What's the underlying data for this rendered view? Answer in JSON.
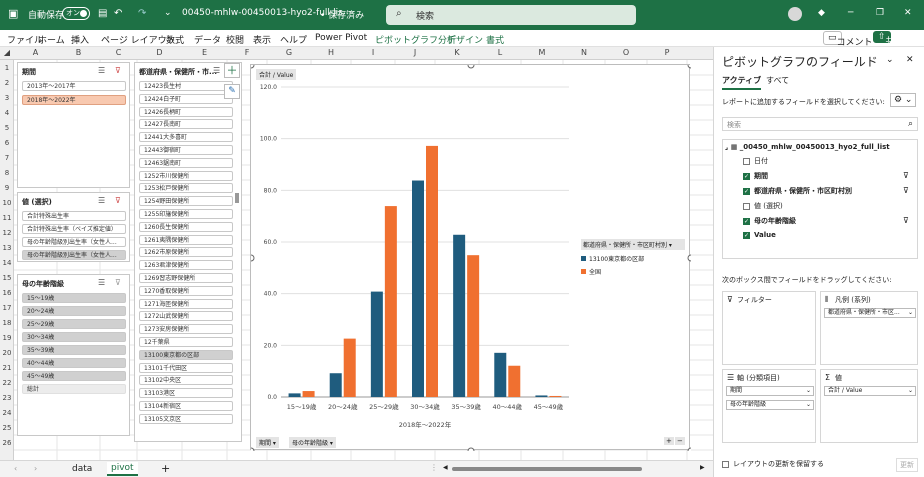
{
  "titlebar": {
    "autosave": "自動保存",
    "toggle": "オン",
    "filename": "00450-mhlw-00450013-hyo2-full-lis···",
    "saved": "• 保存済み",
    "search": "検索"
  },
  "menu": [
    "ファイル",
    "ホーム",
    "挿入",
    "ページ レイアウト",
    "数式",
    "データ",
    "校閲",
    "表示",
    "ヘルプ",
    "Power Pivot",
    "ピボットグラフ分析",
    "デザイン",
    "書式"
  ],
  "menu_right": {
    "comment": "コメント",
    "share": "共有"
  },
  "columns": [
    "A",
    "B",
    "C",
    "D",
    "E",
    "F",
    "G",
    "H",
    "I",
    "J",
    "K",
    "L",
    "M",
    "N",
    "O",
    "P"
  ],
  "rows": [
    "1",
    "2",
    "3",
    "4",
    "5",
    "6",
    "7",
    "8",
    "9",
    "10",
    "11",
    "12",
    "13",
    "14",
    "15",
    "16",
    "17",
    "18",
    "19",
    "20",
    "21",
    "22",
    "23",
    "24",
    "25",
    "26"
  ],
  "slicer_period": {
    "title": "期間",
    "items": [
      "2013年～2017年",
      "2018年～2022年"
    ]
  },
  "slicer_value": {
    "title": "値 (選択)",
    "items": [
      "合計特殊出生率",
      "合計特殊出生率（ベイズ推定値）",
      "母の年齢階級別出生率（女性人...",
      "母の年齢階級別出生率（女性人..."
    ]
  },
  "slicer_age": {
    "title": "母の年齢階級",
    "items": [
      "15～19歳",
      "20～24歳",
      "25～29歳",
      "30～34歳",
      "35～39歳",
      "40～44歳",
      "45～49歳",
      "総計"
    ]
  },
  "slicer_pref": {
    "title": "都道府県・保健所・市...",
    "items": [
      "12423長生村",
      "12424白子町",
      "12426長柄町",
      "12427長南町",
      "12441大多喜町",
      "12443御宿町",
      "12463鋸南町",
      "1252市川保健所",
      "1253松戸保健所",
      "1254野田保健所",
      "1255印旛保健所",
      "1260長生保健所",
      "1261夷隅保健所",
      "1262市原保健所",
      "1263君津保健所",
      "1269習志野保健所",
      "1270香取保健所",
      "1271海匝保健所",
      "1272山武保健所",
      "1273安房保健所",
      "12千葉県",
      "13100東京都の区部",
      "13101千代田区",
      "13102中央区",
      "13103港区",
      "13104新宿区",
      "13105文京区"
    ]
  },
  "chart": {
    "value_label": "合計 / Value",
    "legend_title": "都道府県・保健所・市区町村別",
    "xlabel": "2018年～2022年",
    "axis_button": "期間",
    "axis_button2": "母の年齢階級"
  },
  "chart_data": {
    "type": "bar",
    "categories": [
      "15～19歳",
      "20～24歳",
      "25～29歳",
      "30～34歳",
      "35～39歳",
      "40～44歳",
      "45～49歳"
    ],
    "series": [
      {
        "name": "13100東京都の区部",
        "color": "#1f5c7e",
        "values": [
          1.4,
          9.2,
          40.8,
          83.8,
          62.8,
          17.1,
          0.6
        ]
      },
      {
        "name": "全国",
        "color": "#f07030",
        "values": [
          2.3,
          22.6,
          73.9,
          97.2,
          54.9,
          12.1,
          0.4
        ]
      }
    ],
    "ylim": [
      0,
      120
    ],
    "yticks": [
      "0.0",
      "20.0",
      "40.0",
      "60.0",
      "80.0",
      "100.0",
      "120.0"
    ]
  },
  "field_panel": {
    "title": "ピボットグラフのフィールド",
    "tab_active": "アクティブ",
    "tab_all": "すべて",
    "instruction": "レポートに追加するフィールドを選択してください:",
    "search_placeholder": "検索",
    "table_name": "_00450_mhlw_00450013_hyo2_full_list",
    "fields": [
      {
        "label": "日付",
        "checked": false
      },
      {
        "label": "期間",
        "checked": true
      },
      {
        "label": "都道府県・保健所・市区町村別",
        "checked": true
      },
      {
        "label": "値 (選択)",
        "checked": false
      },
      {
        "label": "母の年齢階級",
        "checked": true
      },
      {
        "label": "Value",
        "checked": true
      }
    ],
    "drag_hint": "次のボックス間でフィールドをドラッグしてください:",
    "filter_label": "フィルター",
    "legend_label": "凡例 (系列)",
    "legend_item": "都道府県・保健所・市区...",
    "axis_label": "軸 (分類項目)",
    "axis_item1": "期間",
    "axis_item2": "母の年齢階級",
    "values_label": "値",
    "values_item": "合計 / Value",
    "defer": "レイアウトの更新を保留する",
    "update": "更新"
  },
  "sheets": {
    "tab1": "data",
    "tab2": "pivot"
  }
}
